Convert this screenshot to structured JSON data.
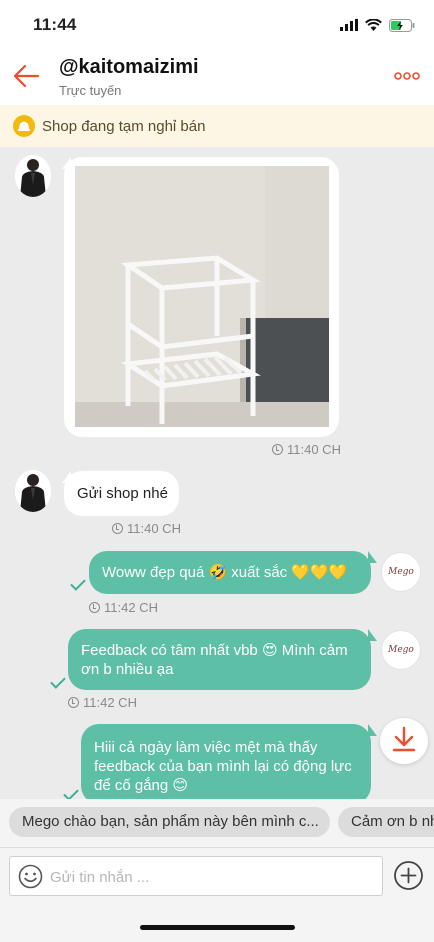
{
  "status_bar": {
    "time": "11:44"
  },
  "header": {
    "title": "@kaitomaizimi",
    "subtitle": "Trực tuyến"
  },
  "notice": {
    "text": "Shop đang tạm nghỉ bán"
  },
  "brand": {
    "avatar_text": "Mego"
  },
  "messages": [
    {
      "sender": "shop",
      "type": "image",
      "time": "11:40 CH"
    },
    {
      "sender": "shop",
      "type": "text",
      "text": "Gửi shop nhé",
      "time": "11:40 CH"
    },
    {
      "sender": "me",
      "type": "text",
      "text": "Woww đẹp quá 🤣 xuất sắc 💛💛💛",
      "time": "11:42 CH",
      "status": "sent"
    },
    {
      "sender": "me",
      "type": "text",
      "text": "Feedback có tâm nhất vbb 😍 Mình cảm ơn b nhiều ạa",
      "time": "11:42 CH",
      "status": "sent"
    },
    {
      "sender": "me",
      "type": "text",
      "text": "Hiii cả ngày làm việc mệt mà thấy feedback của bạn mình lại có động lực để cố gắng 😊",
      "status": "sent"
    }
  ],
  "quick_replies": [
    "Mego chào bạn, sản phẩm này bên mình c...",
    "Cảm ơn b nh"
  ],
  "composer": {
    "placeholder": "Gửi tin nhắn ..."
  },
  "colors": {
    "accent": "#ee4d2d",
    "bubble_out": "#5dbfa5",
    "notice_bg": "#fdf6e4"
  }
}
